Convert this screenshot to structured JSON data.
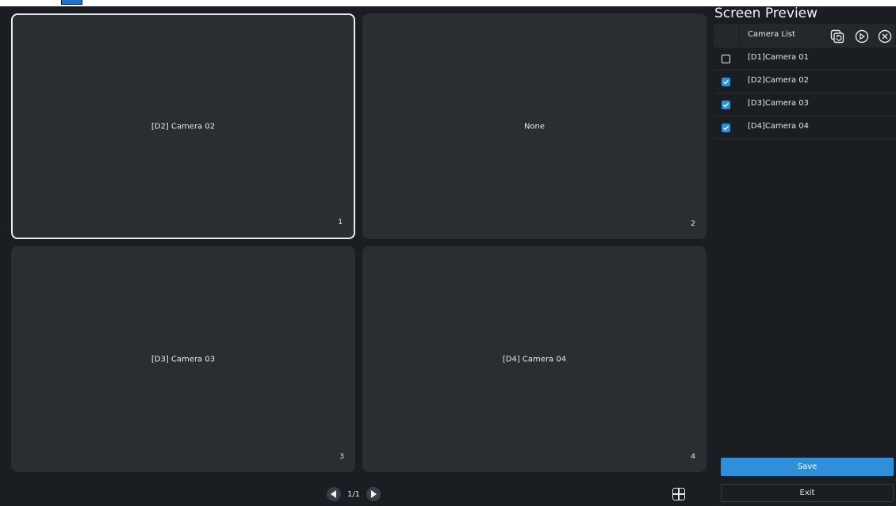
{
  "panel": {
    "title": "Screen Preview",
    "list_header": "Camera List",
    "header_icons": [
      "refresh-icon",
      "play-icon",
      "close-icon"
    ],
    "cameras": [
      {
        "label": "[D1]Camera 01",
        "checked": false
      },
      {
        "label": "[D2]Camera 02",
        "checked": true
      },
      {
        "label": "[D3]Camera 03",
        "checked": true
      },
      {
        "label": "[D4]Camera 04",
        "checked": true
      }
    ],
    "save_label": "Save",
    "exit_label": "Exit"
  },
  "grid": {
    "tiles": [
      {
        "label": "[D2] Camera 02",
        "number": "1",
        "selected": true
      },
      {
        "label": "None",
        "number": "2",
        "selected": false
      },
      {
        "label": "[D3] Camera 03",
        "number": "3",
        "selected": false
      },
      {
        "label": "[D4] Camera 04",
        "number": "4",
        "selected": false
      }
    ]
  },
  "pager": {
    "page_text": "1/1"
  },
  "colors": {
    "accent": "#2f8fd8",
    "background": "#1a1d21",
    "tile": "#2a2d32"
  }
}
